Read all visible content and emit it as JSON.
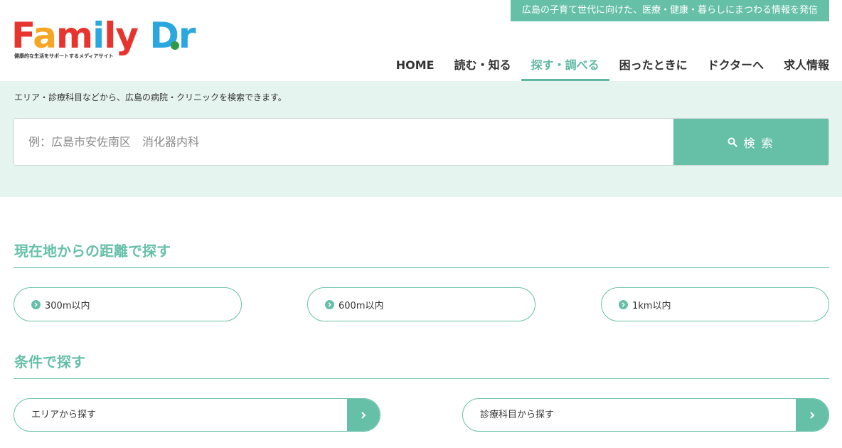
{
  "header": {
    "tagline": "広島の子育て世代に向けた、医療・健康・暮らしにまつわる情報を発信",
    "logo_text": "Family Dr.",
    "logo_subtitle": "健康的な生活をサポートするメディアサイト"
  },
  "nav": {
    "items": [
      {
        "label": "HOME"
      },
      {
        "label": "読む・知る"
      },
      {
        "label": "探す・調べる",
        "active": true
      },
      {
        "label": "困ったときに"
      },
      {
        "label": "ドクターへ"
      },
      {
        "label": "求人情報"
      }
    ]
  },
  "search": {
    "description": "エリア・診療科目などから、広島の病院・クリニックを検索できます。",
    "placeholder": "例：広島市安佐南区　消化器内科",
    "value": "",
    "button_label": "検 索"
  },
  "distance_section": {
    "title": "現在地からの距離で探す",
    "options": [
      {
        "label": "300m以内"
      },
      {
        "label": "600m以内"
      },
      {
        "label": "1km以内"
      }
    ]
  },
  "condition_section": {
    "title": "条件で探す",
    "options": [
      {
        "label": "エリアから探す"
      },
      {
        "label": "診療科目から探す"
      }
    ]
  },
  "colors": {
    "accent": "#66c0a8",
    "band_bg": "#e6f4ef",
    "logo_red": "#e8342e",
    "logo_blue": "#2ba7df",
    "logo_orange": "#f6a623"
  },
  "icons": {
    "search": "search-icon",
    "chevron": "chevron-right-icon"
  }
}
